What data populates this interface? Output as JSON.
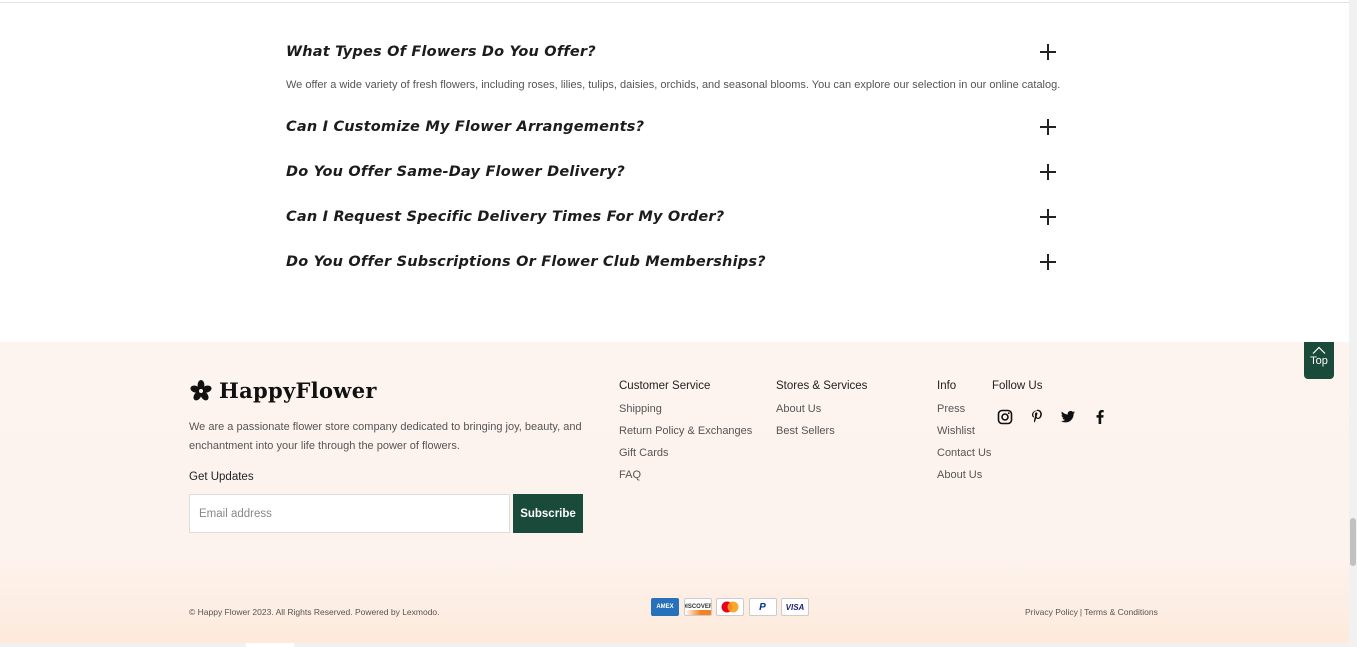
{
  "faq": {
    "items": [
      {
        "question": "What Types Of Flowers Do You Offer?",
        "answer": "We offer a wide variety of fresh flowers, including roses, lilies, tulips, daisies, orchids, and seasonal blooms. You can explore our selection in our online catalog.",
        "expanded": true
      },
      {
        "question": "Can I Customize My Flower Arrangements?",
        "expanded": false
      },
      {
        "question": "Do You Offer Same-Day Flower Delivery?",
        "expanded": false
      },
      {
        "question": "Can I Request Specific Delivery Times For My Order?",
        "expanded": false
      },
      {
        "question": "Do You Offer Subscriptions Or Flower Club Memberships?",
        "expanded": false
      }
    ]
  },
  "footer": {
    "brand_name": "HappyFlower",
    "description": "We are a passionate flower store company dedicated to bringing joy, beauty, and enchantment into your life through the power of flowers.",
    "updates_label": "Get Updates",
    "email_placeholder": "Email address",
    "subscribe_label": "Subscribe",
    "customer_service": {
      "heading": "Customer Service",
      "links": [
        "Shipping",
        "Return Policy & Exchanges",
        "Gift Cards",
        "FAQ"
      ]
    },
    "stores_services": {
      "heading": "Stores & Services",
      "links": [
        "About Us",
        "Best Sellers"
      ]
    },
    "info": {
      "heading": "Info",
      "links": [
        "Press",
        "Wishlist",
        "Contact Us",
        "About Us"
      ]
    },
    "follow": {
      "heading": "Follow Us",
      "icons": [
        "instagram-icon",
        "pinterest-icon",
        "twitter-icon",
        "facebook-icon"
      ]
    },
    "top_label": "Top",
    "copyright": "© Happy Flower 2023. All Rights Reserved. Powered by Lexmodo.",
    "payments": [
      "AMEX",
      "DISCOVER",
      "mastercard",
      "P",
      "VISA"
    ],
    "privacy_label": "Privacy Policy",
    "legal_sep": "|",
    "terms_label": "Terms & Conditions"
  },
  "colors": {
    "accent": "#1a4a3a",
    "footer_bg": "#fdf3ef"
  }
}
